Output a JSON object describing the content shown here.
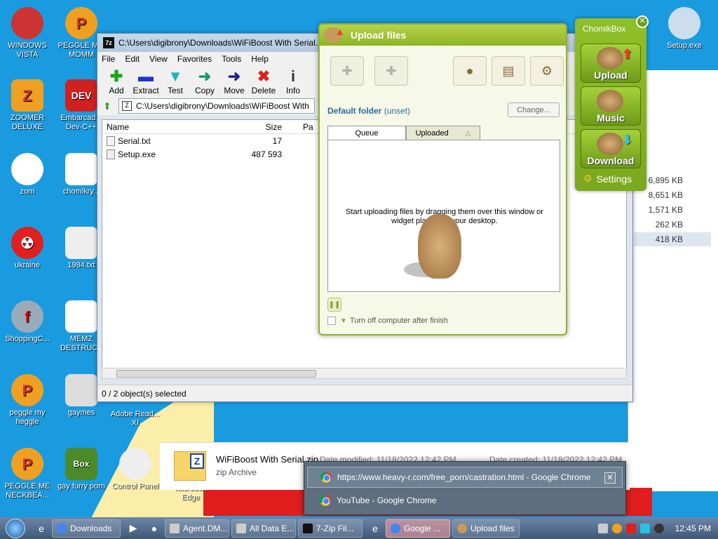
{
  "desktop": {
    "icons": [
      {
        "label": "WINDOWS VISTA"
      },
      {
        "label": "PEGGLE M... MOMM"
      },
      {
        "label": "ZOOMER DELUXE"
      },
      {
        "label": "Embarcad... Dev-C++"
      },
      {
        "label": "zom"
      },
      {
        "label": "chomikry..."
      },
      {
        "label": "ukraine"
      },
      {
        "label": "1984.txt"
      },
      {
        "label": "ShoppingC..."
      },
      {
        "label": "MEMZ DESTRUCT"
      },
      {
        "label": "peggle my heggle"
      },
      {
        "label": "gaymes"
      },
      {
        "label": "Adobe Read... XI"
      },
      {
        "label": "PEGGLE ME NECKBEA..."
      },
      {
        "label": "gay furry porn"
      },
      {
        "label": "Control Panel"
      },
      {
        "label": "Microsoft Edge"
      },
      {
        "label": "Setup.exe"
      }
    ]
  },
  "sevenzip": {
    "title": "C:\\Users\\digibrony\\Downloads\\WiFiBoost With Serial.z",
    "menu": [
      "File",
      "Edit",
      "View",
      "Favorites",
      "Tools",
      "Help"
    ],
    "toolbar": [
      {
        "label": "Add",
        "icon": "plus-icon"
      },
      {
        "label": "Extract",
        "icon": "minus-icon"
      },
      {
        "label": "Test",
        "icon": "check-icon"
      },
      {
        "label": "Copy",
        "icon": "copy-arrow-icon"
      },
      {
        "label": "Move",
        "icon": "move-arrow-icon"
      },
      {
        "label": "Delete",
        "icon": "delete-x-icon"
      },
      {
        "label": "Info",
        "icon": "info-icon"
      }
    ],
    "address": "C:\\Users\\digibrony\\Downloads\\WiFiBoost With",
    "columns": {
      "name": "Name",
      "size": "Size",
      "packed": "Pa"
    },
    "files": [
      {
        "name": "Serial.txt",
        "size": "17"
      },
      {
        "name": "Setup.exe",
        "size": "487 593"
      }
    ],
    "status": "0 / 2 object(s) selected",
    "scroll_fraction": 0.37
  },
  "upload": {
    "title": "Upload files",
    "default_folder_label": "Default folder",
    "default_folder_value": "(unset)",
    "change_label": "Change...",
    "tab_queue": "Queue",
    "tab_uploaded": "Uploaded",
    "message": "Start uploading files by dragging them over this window or widget placed on your desktop.",
    "turn_off_label": "Turn off computer after finish"
  },
  "chomikbox": {
    "title": "ChomikBox",
    "upload": "Upload",
    "music": "Music",
    "download": "Download",
    "settings": "Settings"
  },
  "explorer": {
    "sizes": [
      "6,895 KB",
      "8,651 KB",
      "1,571 KB",
      "262 KB",
      "418 KB"
    ],
    "file_name": "WiFiBoost With Serial.zip",
    "file_type": "zip Archive",
    "date_modified": "Date modified: 11/18/2022 12:42 PM",
    "date_created": "Date created: 11/18/2022 12:42 PM"
  },
  "jumplist": {
    "items": [
      {
        "label": "https://www.heavy-r.com/free_porn/castration.html - Google Chrome"
      },
      {
        "label": "YouTube - Google Chrome"
      }
    ]
  },
  "taskbar": {
    "items": [
      {
        "label": "Downloads"
      },
      {
        "label": "Agent.DM..."
      },
      {
        "label": "All Data E..."
      },
      {
        "label": "7-Zip Fil..."
      },
      {
        "label": "Google ..."
      },
      {
        "label": "Upload files"
      }
    ],
    "clock": "12:45 PM"
  }
}
